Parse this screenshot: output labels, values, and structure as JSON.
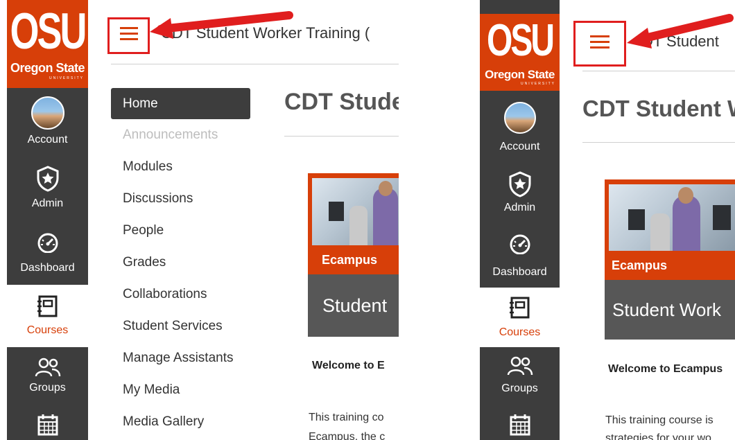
{
  "logo": {
    "initials": "OSU",
    "name": "Oregon State",
    "sub": "UNIVERSITY"
  },
  "global_nav": [
    {
      "label": "Account",
      "icon": "avatar-icon"
    },
    {
      "label": "Admin",
      "icon": "shield-star-icon"
    },
    {
      "label": "Dashboard",
      "icon": "speedometer-icon"
    },
    {
      "label": "Courses",
      "icon": "book-icon",
      "active": true
    },
    {
      "label": "Groups",
      "icon": "groups-icon"
    },
    {
      "label": "",
      "icon": "calendar-icon"
    }
  ],
  "header": {
    "title_left": "CDT Student Worker Training (",
    "title_right": "DT Student"
  },
  "course_nav": [
    {
      "label": "Home",
      "active": true
    },
    {
      "label": "Announcements",
      "disabled": true
    },
    {
      "label": "Modules"
    },
    {
      "label": "Discussions"
    },
    {
      "label": "People"
    },
    {
      "label": "Grades"
    },
    {
      "label": "Collaborations"
    },
    {
      "label": "Student Services"
    },
    {
      "label": "Manage Assistants"
    },
    {
      "label": "My Media"
    },
    {
      "label": "Media Gallery"
    }
  ],
  "page": {
    "heading_left": "CDT Stude",
    "heading_right": "CDT Student W",
    "banner_org": "Ecampus",
    "banner_title_left": "Student",
    "banner_title_right": "Student Work",
    "welcome_left": "Welcome to E",
    "welcome_right": "Welcome to Ecampus",
    "body_line1_left": "This training co",
    "body_line2_left": "Ecampus, the c",
    "body_line1_right": "This training course is",
    "body_line2_right": "strategies for your wo"
  },
  "colors": {
    "brand": "#d73f09",
    "nav_bg": "#3d3d3d",
    "highlight": "#e01e1e"
  }
}
